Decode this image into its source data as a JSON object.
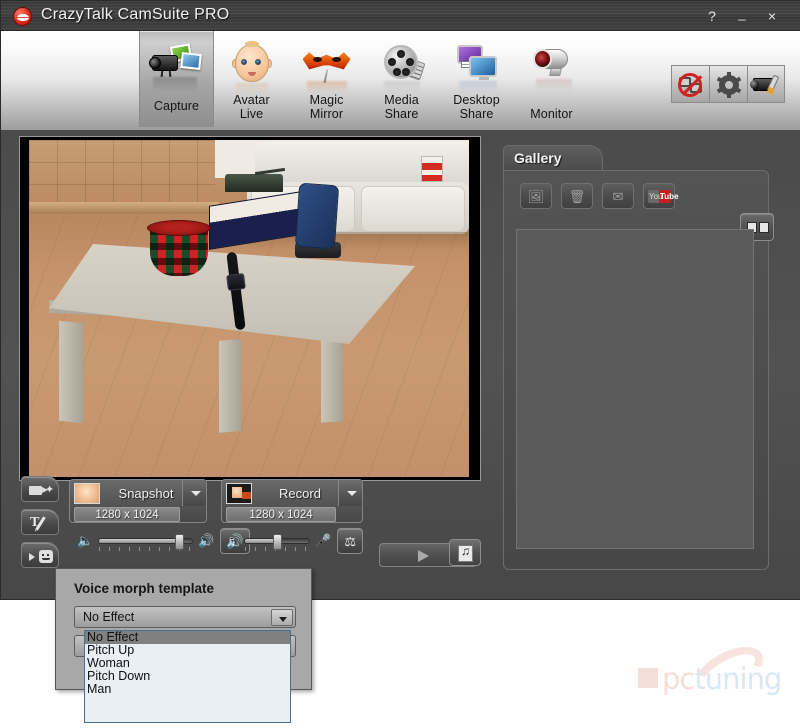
{
  "window": {
    "title": "CrazyTalk CamSuite PRO",
    "logo_icon": "lips-logo-icon",
    "controls": {
      "help_label": "?",
      "minimize_label": "_",
      "close_label": "×"
    }
  },
  "toolbar": {
    "items": [
      {
        "label": "Capture",
        "icon": "camcorder-photos-icon",
        "selected": true
      },
      {
        "label": "Avatar\nLive",
        "icon": "baby-face-icon",
        "selected": false
      },
      {
        "label": "Magic\nMirror",
        "icon": "carnival-mask-icon",
        "selected": false
      },
      {
        "label": "Media\nShare",
        "icon": "film-reel-icon",
        "selected": false
      },
      {
        "label": "Desktop\nShare",
        "icon": "dual-monitor-icon",
        "selected": false
      },
      {
        "label": "Monitor",
        "icon": "security-camera-icon",
        "selected": false
      }
    ],
    "item_labels": {
      "capture": "Capture",
      "avatar_live_line1": "Avatar",
      "avatar_live_line2": "Live",
      "magic_mirror_line1": "Magic",
      "magic_mirror_line2": "Mirror",
      "media_share_line1": "Media",
      "media_share_line2": "Share",
      "desktop_share_line1": "Desktop",
      "desktop_share_line2": "Share",
      "monitor": "Monitor"
    },
    "right_buttons": [
      {
        "icon": "disable-sharing-icon"
      },
      {
        "icon": "gear-settings-icon"
      },
      {
        "icon": "camera-settings-icon"
      }
    ]
  },
  "preview": {
    "source": "webcam-live-feed",
    "description": "Living room with white coffee table, checkered red and green pot, dark box, blue stand and a wristwatch"
  },
  "side_tabs": [
    {
      "icon": "video-effect-icon"
    },
    {
      "icon": "text-annotation-icon"
    },
    {
      "icon": "voice-emotion-icon"
    }
  ],
  "capture": {
    "snapshot": {
      "label": "Snapshot",
      "resolution": "1280 x 1024",
      "thumb_icon": "face-photo-thumb-icon",
      "dropdown_icon": "chevron-down-icon"
    },
    "record": {
      "label": "Record",
      "resolution": "1280 x 1024",
      "thumb_icon": "video-camera-thumb-icon",
      "dropdown_icon": "chevron-down-icon"
    }
  },
  "audio": {
    "speaker": {
      "left_icon": "speaker-low-icon",
      "right_icon": "speaker-high-icon",
      "mute_button_icon": "speaker-icon",
      "value_percent": 88
    },
    "microphone": {
      "left_icon": "music-note-icon",
      "right_icon": "microphone-icon",
      "morph_button_icon": "voice-morph-icon",
      "value_percent": 50
    }
  },
  "playback": {
    "play_icon": "play-icon",
    "music_file_icon": "music-file-icon"
  },
  "gallery": {
    "tab_label": "Gallery",
    "tools": [
      {
        "icon": "slideshow-icon"
      },
      {
        "icon": "trash-icon"
      },
      {
        "icon": "email-icon"
      },
      {
        "icon": "youtube-icon",
        "text_a": "You",
        "text_b": "Tube"
      }
    ],
    "view_toggle_icon": "thumbnail-view-icon",
    "items": []
  },
  "voice_morph_popup": {
    "title": "Voice morph template",
    "combo_value": "No Effect",
    "combo_arrow_icon": "chevron-down-icon",
    "options": [
      "No Effect",
      "Pitch Up",
      "Woman",
      "Pitch Down",
      "Man"
    ],
    "selected_index": 0
  },
  "watermark": {
    "text_pc": "pc",
    "text_tuning": "tuning"
  },
  "colors": {
    "window_chrome": "#4f4f4f",
    "titlebar": "#3f3f3f",
    "toolbar_top": "#ffffff",
    "toolbar_bottom": "#9d9d9d",
    "accent_red": "#d12b22",
    "listbox_bg": "#eaeff5",
    "listbox_selected": "#808080"
  }
}
